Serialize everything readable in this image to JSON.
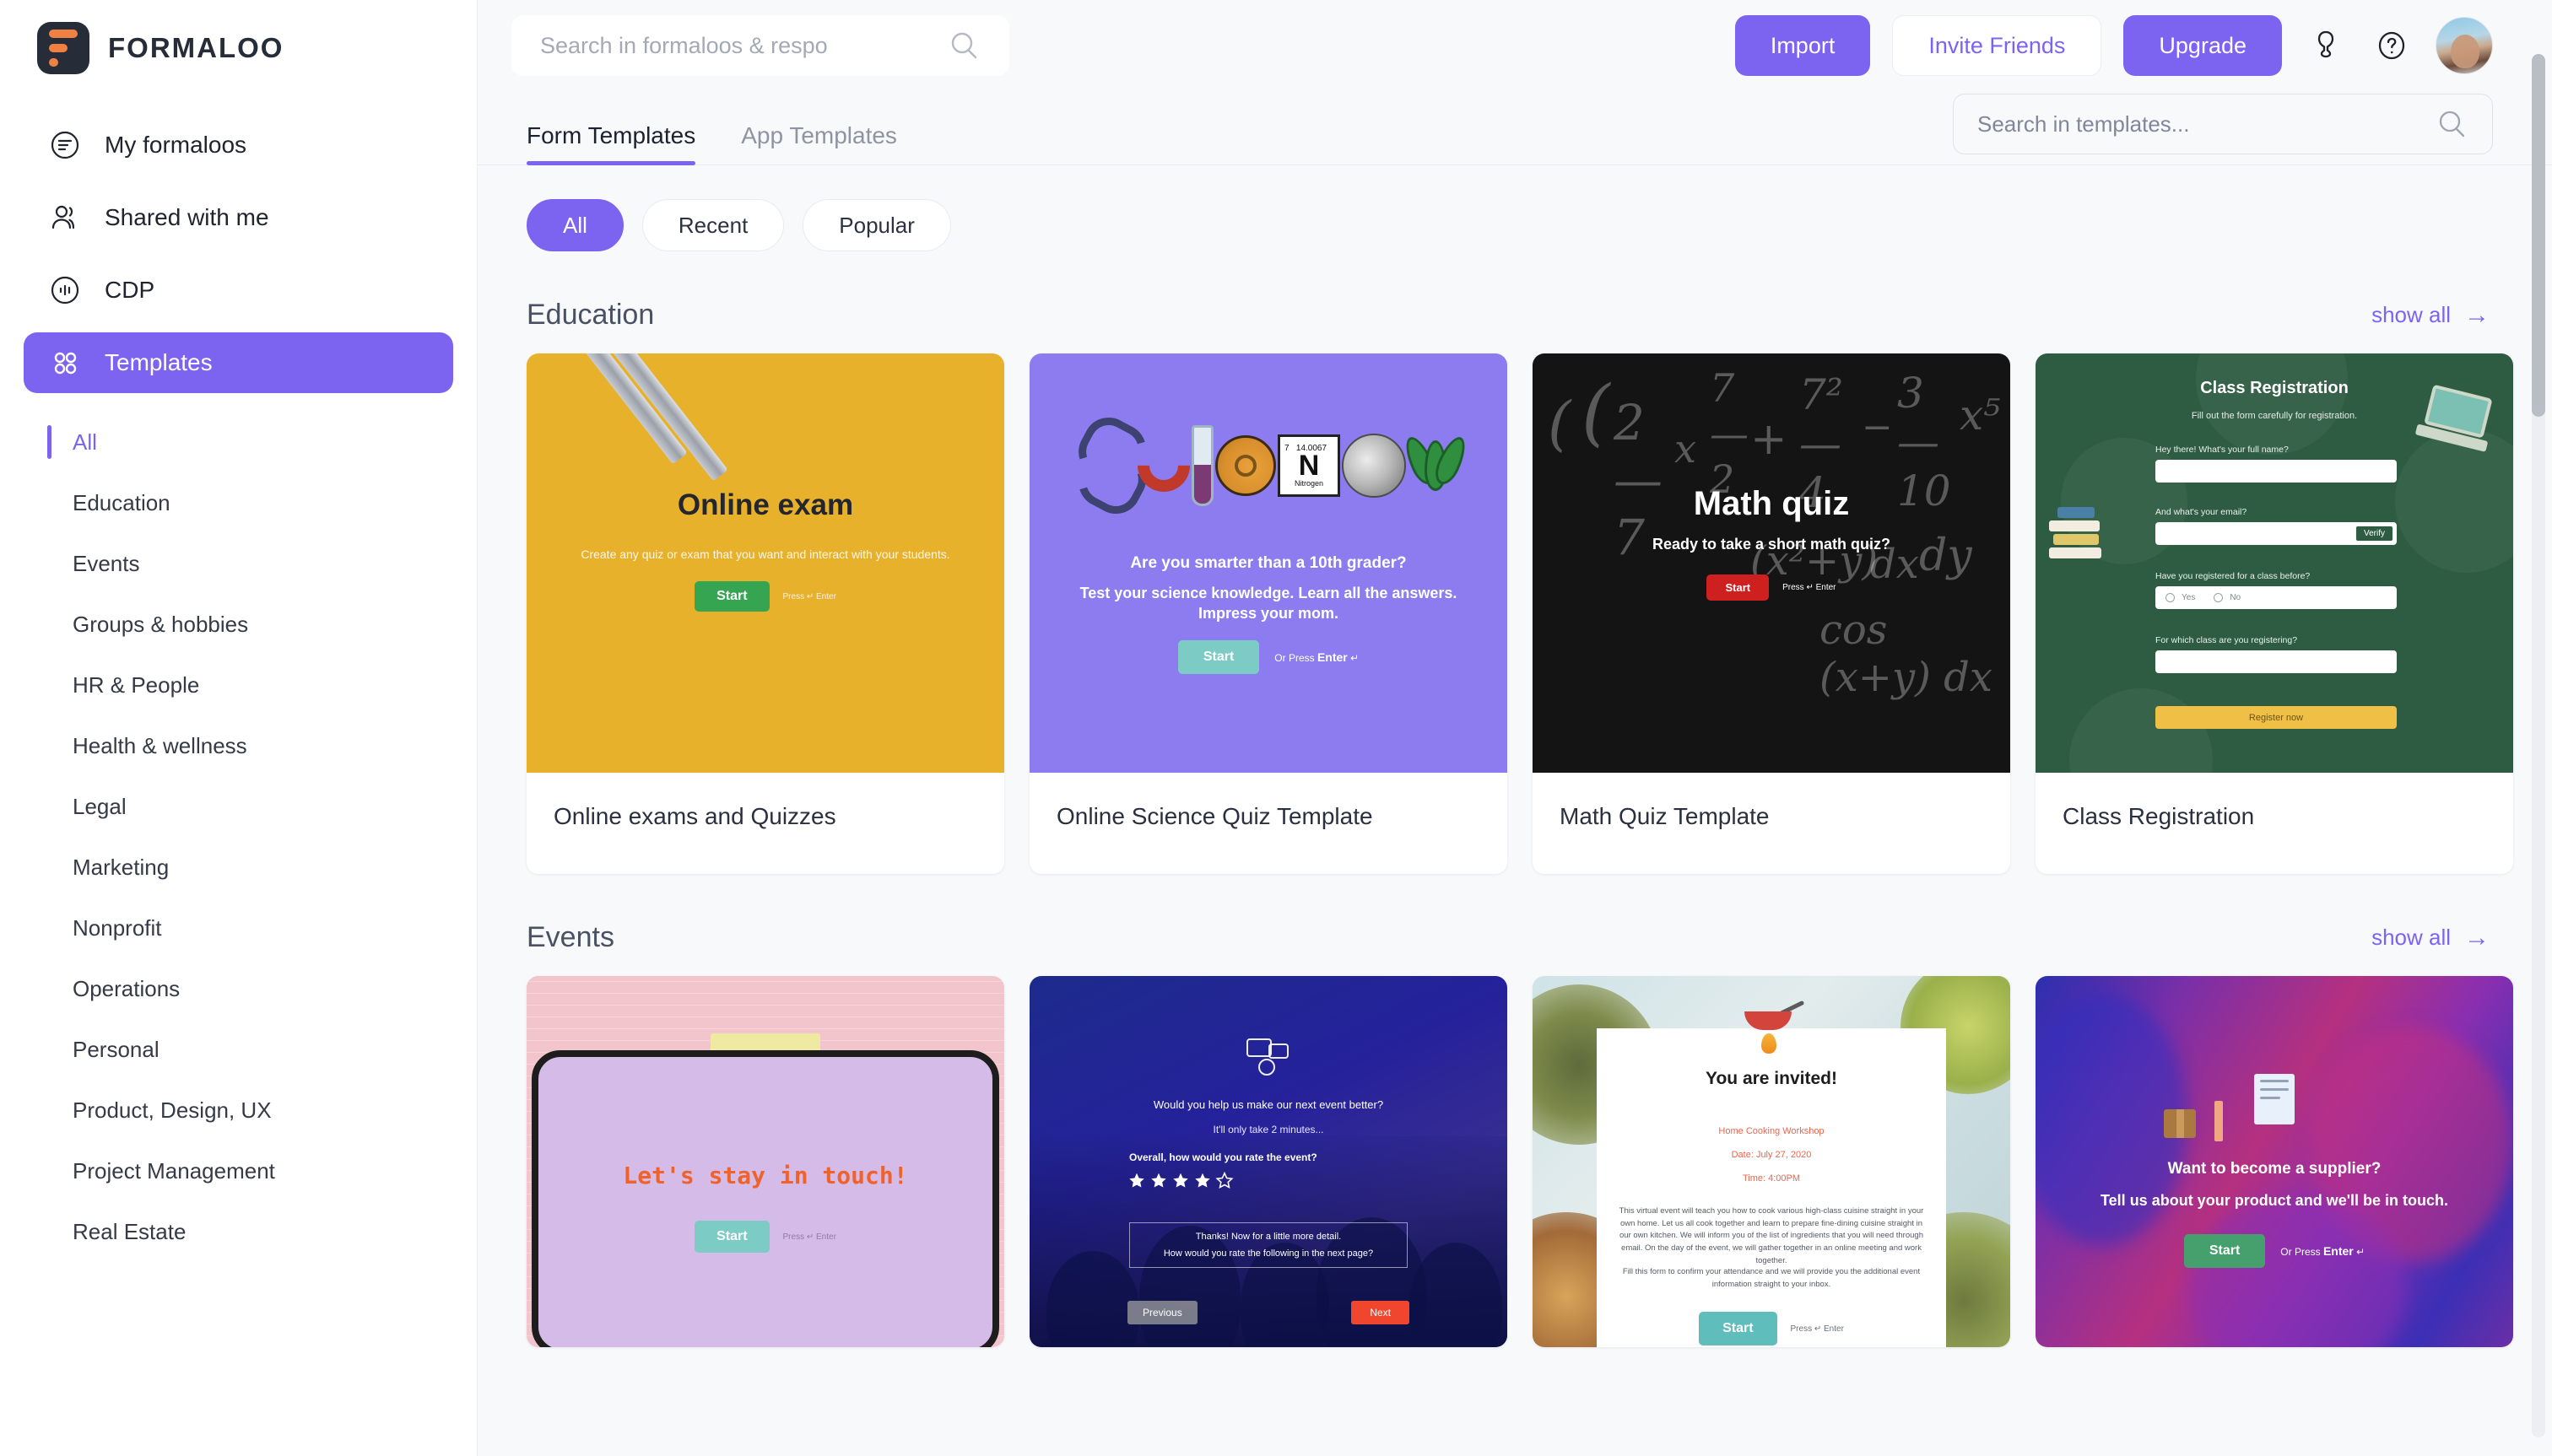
{
  "brand": {
    "name": "FORMALOO"
  },
  "sidebar": {
    "nav": [
      {
        "label": "My formaloos",
        "icon": "list-circle-icon"
      },
      {
        "label": "Shared with me",
        "icon": "users-icon"
      },
      {
        "label": "CDP",
        "icon": "chart-circle-icon"
      },
      {
        "label": "Templates",
        "icon": "grid-icon"
      }
    ],
    "categories": [
      "All",
      "Education",
      "Events",
      "Groups & hobbies",
      "HR & People",
      "Health & wellness",
      "Legal",
      "Marketing",
      "Nonprofit",
      "Operations",
      "Personal",
      "Product, Design, UX",
      "Project Management",
      "Real Estate"
    ]
  },
  "topbar": {
    "search_placeholder": "Search in formaloos & respo",
    "import_label": "Import",
    "invite_label": "Invite Friends",
    "upgrade_label": "Upgrade"
  },
  "tabs": [
    {
      "label": "Form Templates",
      "active": true
    },
    {
      "label": "App Templates",
      "active": false
    }
  ],
  "template_search_placeholder": "Search in templates...",
  "filters": [
    {
      "label": "All",
      "active": true
    },
    {
      "label": "Recent",
      "active": false
    },
    {
      "label": "Popular",
      "active": false
    }
  ],
  "show_all_label": "show all",
  "sections": [
    {
      "title": "Education",
      "cards": [
        {
          "title": "Online exams and Quizzes",
          "preview": {
            "heading": "Online exam",
            "subtitle": "Create any quiz or exam that you want and interact with your students.",
            "button": "Start",
            "hint": "Press ↵ Enter"
          }
        },
        {
          "title": "Online Science Quiz Template",
          "preview": {
            "word": "Science",
            "element_number": "7",
            "element_weight": "14.0067",
            "element_symbol": "N",
            "element_name": "Nitrogen",
            "question": "Are you smarter than a 10th grader?",
            "subtitle": "Test your science knowledge. Learn all the answers. Impress your mom.",
            "button": "Start",
            "hint_prefix": "Or Press",
            "hint_key": "Enter"
          }
        },
        {
          "title": "Math Quiz Template",
          "preview": {
            "heading": "Math quiz",
            "subtitle": "Ready to take a short math quiz?",
            "button": "Start",
            "hint": "Press ↵ Enter"
          }
        },
        {
          "title": "Class Registration",
          "preview": {
            "heading": "Class Registration",
            "subtitle": "Fill out the form carefully for registration.",
            "q1": "Hey there! What's your full name?",
            "q2": "And what's your email?",
            "verify": "Verify",
            "q3": "Have you registered for a class before?",
            "opt_yes": "Yes",
            "opt_no": "No",
            "q4": "For which class are you registering?",
            "submit": "Register now"
          }
        }
      ]
    },
    {
      "title": "Events",
      "cards": [
        {
          "title": "",
          "preview": {
            "heading": "Let's stay in touch!",
            "button": "Start",
            "hint": "Press ↵ Enter"
          }
        },
        {
          "title": "",
          "preview": {
            "q1": "Would you help us make our next event better?",
            "q2": "It'll only take 2 minutes...",
            "q3": "Overall, how would you rate the event?",
            "rating": 4,
            "rating_max": 5,
            "box_line1": "Thanks! Now for a little more detail.",
            "box_line2": "How would you rate the following in the next page?",
            "prev": "Previous",
            "next": "Next"
          }
        },
        {
          "title": "",
          "preview": {
            "heading": "You are invited!",
            "event_name": "Home Cooking Workshop",
            "event_date": "Date: July 27, 2020",
            "event_time": "Time: 4:00PM",
            "body": "This virtual event will teach you how to cook various high-class cuisine straight in your own home. Let us all cook together and learn to prepare fine-dining cuisine straight in our own kitchen. We will inform you of the list of ingredients that you will need through email. On the day of the event, we will gather together in an online meeting and work together.",
            "body2": "Fill this form to confirm your attendance and we will provide you the additional event information straight to your inbox.",
            "button": "Start",
            "hint": "Press ↵ Enter"
          }
        },
        {
          "title": "",
          "preview": {
            "q1": "Want to become a supplier?",
            "q2": "Tell us about your product and we'll be in touch.",
            "button": "Start",
            "hint_prefix": "Or Press",
            "hint_key": "Enter"
          }
        }
      ]
    }
  ],
  "colors": {
    "accent": "#7c63f0",
    "brand_dark": "#262c38",
    "brand_orange": "#ef8242"
  }
}
